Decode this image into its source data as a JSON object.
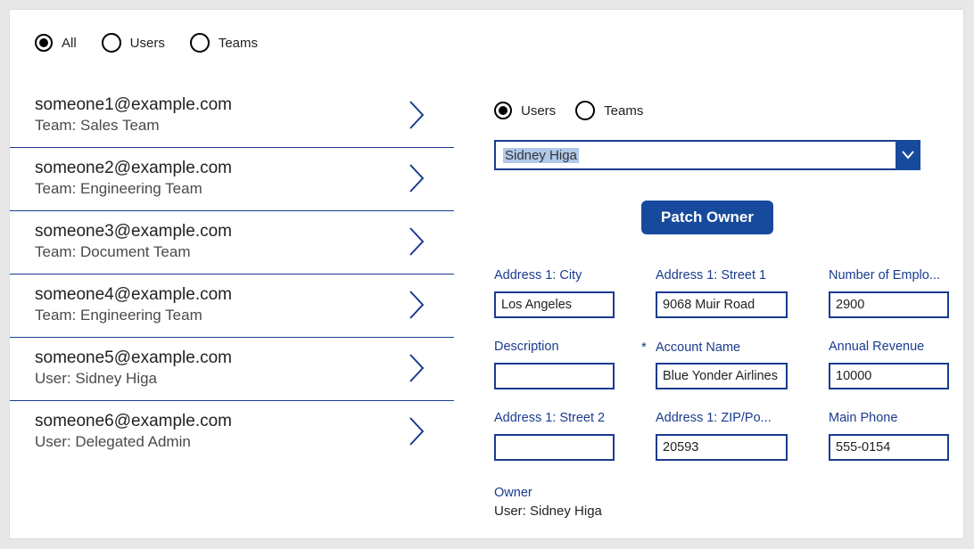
{
  "topFilter": {
    "options": [
      {
        "label": "All",
        "selected": true
      },
      {
        "label": "Users",
        "selected": false
      },
      {
        "label": "Teams",
        "selected": false
      }
    ]
  },
  "list": [
    {
      "title": "someone1@example.com",
      "sub": "Team: Sales Team"
    },
    {
      "title": "someone2@example.com",
      "sub": "Team: Engineering Team"
    },
    {
      "title": "someone3@example.com",
      "sub": "Team: Document Team"
    },
    {
      "title": "someone4@example.com",
      "sub": "Team: Engineering Team"
    },
    {
      "title": "someone5@example.com",
      "sub": "User: Sidney Higa"
    },
    {
      "title": "someone6@example.com",
      "sub": "User: Delegated Admin"
    }
  ],
  "detail": {
    "ownerTypeOptions": [
      {
        "label": "Users",
        "selected": true
      },
      {
        "label": "Teams",
        "selected": false
      }
    ],
    "selectValue": "Sidney Higa",
    "patchButton": "Patch Owner",
    "fields": {
      "city": {
        "label": "Address 1: City",
        "value": "Los Angeles"
      },
      "street1": {
        "label": "Address 1: Street 1",
        "value": "9068 Muir Road"
      },
      "employees": {
        "label": "Number of Emplo...",
        "value": "2900"
      },
      "description": {
        "label": "Description",
        "value": ""
      },
      "accountName": {
        "label": "Account Name",
        "value": "Blue Yonder Airlines",
        "required": true
      },
      "revenue": {
        "label": "Annual Revenue",
        "value": "10000"
      },
      "street2": {
        "label": "Address 1: Street 2",
        "value": ""
      },
      "zip": {
        "label": "Address 1: ZIP/Po...",
        "value": "20593"
      },
      "mainPhone": {
        "label": "Main Phone",
        "value": "555-0154"
      }
    },
    "owner": {
      "label": "Owner",
      "value": "User: Sidney Higa"
    }
  }
}
